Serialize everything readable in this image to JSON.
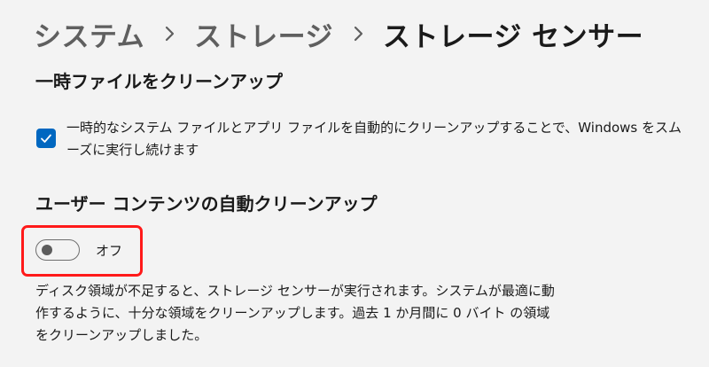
{
  "breadcrumb": {
    "items": [
      "システム",
      "ストレージ"
    ],
    "current": "ストレージ センサー",
    "separator_icon": "chevron-right-icon"
  },
  "temp_files": {
    "heading": "一時ファイルをクリーンアップ",
    "checkbox_label": "一時的なシステム ファイルとアプリ ファイルを自動的にクリーンアップすることで、Windows をスムーズに実行し続けます",
    "checked": true
  },
  "user_content": {
    "heading": "ユーザー コンテンツの自動クリーンアップ",
    "toggle_state_label": "オフ",
    "toggle_on": false,
    "description": "ディスク領域が不足すると、ストレージ センサーが実行されます。システムが最適に動作するように、十分な領域をクリーンアップします。過去 1 か月間に 0 バイト の領域をクリーンアップしました。"
  },
  "colors": {
    "accent": "#0067c0",
    "highlight": "#ff1a1a",
    "background": "#f3f3f3"
  }
}
